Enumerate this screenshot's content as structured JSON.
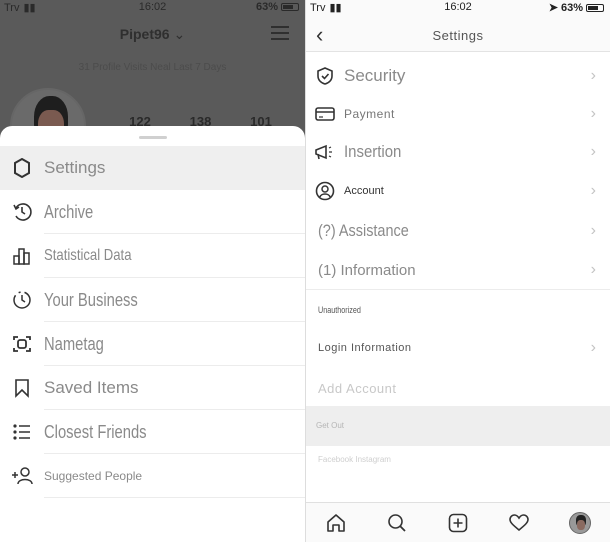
{
  "left": {
    "status": {
      "carrier": "Trv",
      "time": "16:02",
      "battery": "63%"
    },
    "profile": {
      "username": "Pipet96",
      "visits": "31 Profile Visits Neal Last 7 Days",
      "stats": [
        "122",
        "138",
        "101"
      ]
    },
    "menu": [
      {
        "label": "Settings",
        "icon": "settings-icon"
      },
      {
        "label": "Archive",
        "icon": "archive-icon"
      },
      {
        "label": "Statistical Data",
        "icon": "insights-icon"
      },
      {
        "label": "Your Business",
        "icon": "activity-icon"
      },
      {
        "label": "Nametag",
        "icon": "nametag-icon"
      },
      {
        "label": "Saved Items",
        "icon": "bookmark-icon"
      },
      {
        "label": "Closest Friends",
        "icon": "list-icon"
      },
      {
        "label": "Suggested People",
        "icon": "add-person-icon"
      }
    ]
  },
  "right": {
    "status": {
      "carrier": "Trv",
      "time": "16:02",
      "battery": "63%"
    },
    "title": "Settings",
    "items": [
      {
        "label": "Security",
        "icon": "shield-icon"
      },
      {
        "label": "Payment",
        "icon": "card-icon"
      },
      {
        "label": "Insertion",
        "icon": "megaphone-icon"
      },
      {
        "label": "Account",
        "icon": "account-icon"
      },
      {
        "label": "Assistance",
        "prefix": "(?)"
      },
      {
        "label": "Information",
        "prefix": "(1)"
      }
    ],
    "section_unauthorized": "Unauthorized",
    "login_info": "Login Information",
    "add_account": "Add Account",
    "get_out": "Get Out",
    "footer": "Facebook Instagram",
    "tabbar": [
      "home-icon",
      "search-icon",
      "new-post-icon",
      "heart-icon",
      "profile-avatar"
    ]
  }
}
